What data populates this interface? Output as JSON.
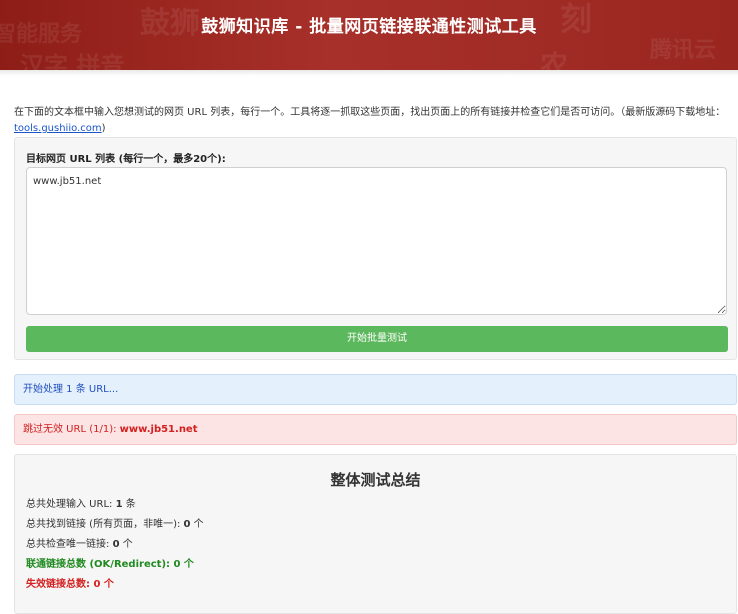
{
  "header": {
    "title": "鼓狮知识库 - 批量网页链接联通性测试工具",
    "background_color": "#9a2620"
  },
  "intro": {
    "text": "在下面的文本框中输入您想测试的网页 URL 列表，每行一个。工具将逐一抓取这些页面，找出页面上的所有链接并检查它们是否可访问。（最新版源码下载地址：",
    "link": "tools.gushiio.com",
    "suffix": ")"
  },
  "form": {
    "label": "目标网页 URL 列表 (每行一个，最多20个):",
    "textarea_value": "www.jb51.net",
    "button_label": "开始批量测试",
    "button_color": "#5cb85c"
  },
  "status": {
    "info": "开始处理 1 条 URL...",
    "error_prefix": "跳过无效 URL (1/1): ",
    "error_url": "www.jb51.net"
  },
  "summary": {
    "title": "整体测试总结",
    "processed_label": "总共处理输入 URL: ",
    "processed_value": "1",
    "processed_unit": " 条",
    "found_label": "总共找到链接 (所有页面，非唯一): ",
    "found_value": "0",
    "found_unit": " 个",
    "unique_label": "总共检查唯一链接: ",
    "unique_value": "0",
    "unique_unit": " 个",
    "ok_text": "联通链接总数 (OK/Redirect): 0 个",
    "bad_text": "失效链接总数: 0 个",
    "ok_color": "#1f8a1f",
    "bad_color": "#d42020"
  }
}
